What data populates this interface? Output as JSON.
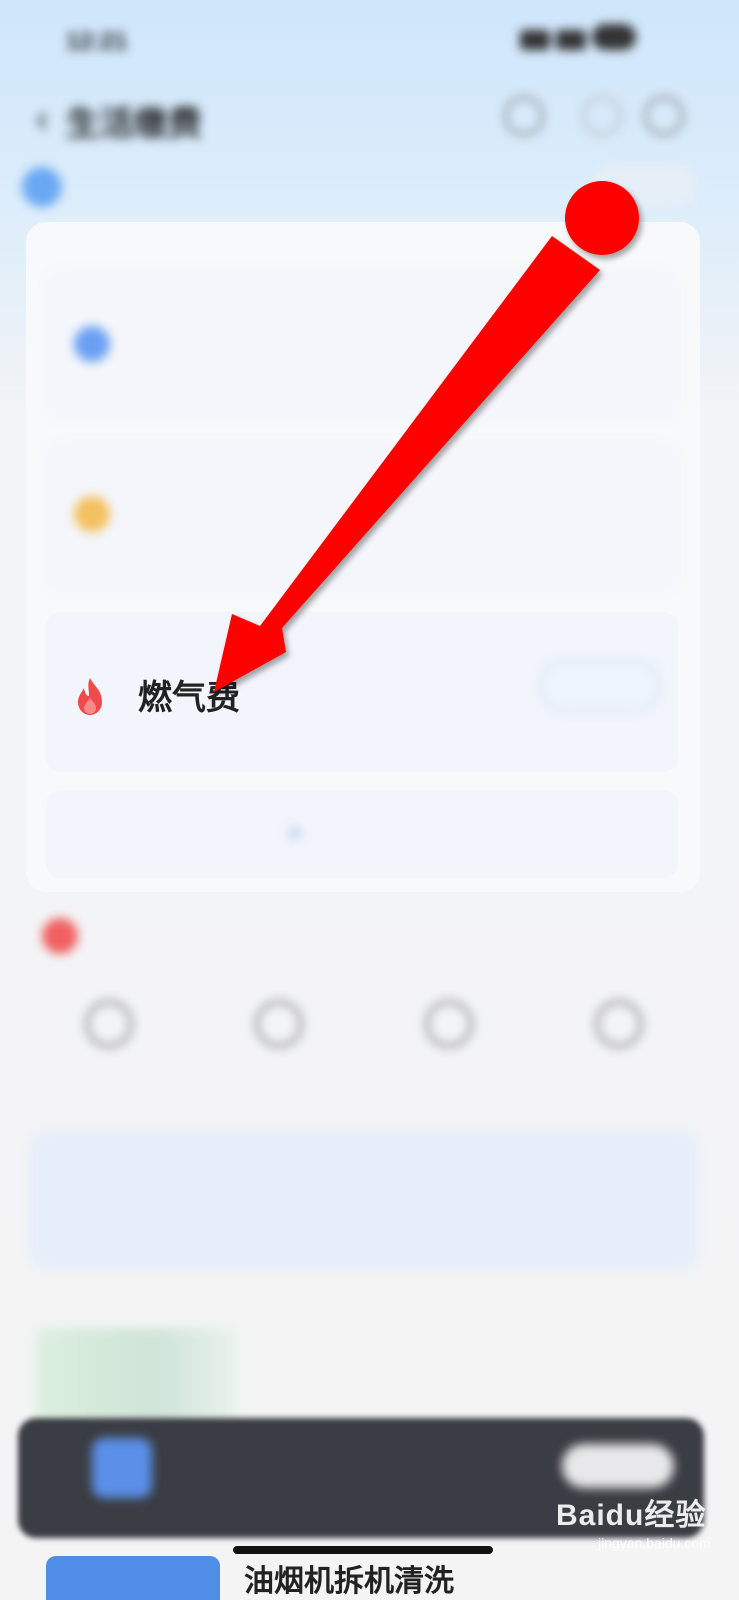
{
  "status": {
    "time": "12:21"
  },
  "header": {
    "title": "生活缴费"
  },
  "notice": {
    "text": "",
    "button": ""
  },
  "bill_items": [
    {
      "title": "",
      "subtitle": "",
      "color": "#6aa0f2"
    },
    {
      "title": "",
      "subtitle": "",
      "color": "#f5c060"
    },
    {
      "title": "燃气费",
      "button": "",
      "color": "#f04a4a"
    }
  ],
  "add_row": {
    "label": ""
  },
  "warning": {
    "text": ""
  },
  "quick_actions": [
    {
      "label": "",
      "icon": "circle-icon"
    },
    {
      "label": "",
      "icon": "circle-icon"
    },
    {
      "label": "",
      "icon": "circle-icon"
    },
    {
      "label": "",
      "icon": "circle-icon"
    }
  ],
  "promo": {
    "title": "",
    "tag": "",
    "sub1": "",
    "sub2": "",
    "sub3": "",
    "label": ""
  },
  "news": {
    "title": ""
  },
  "banner": {
    "text": "",
    "text2": "",
    "button": ""
  },
  "bottom": {
    "thumb_label": "",
    "text": "油烟机拆机清洗"
  },
  "watermark": {
    "text": "Baidu经验",
    "sub": "jingyan.baidu.com"
  },
  "annotation": {
    "color": "#ff0000"
  }
}
